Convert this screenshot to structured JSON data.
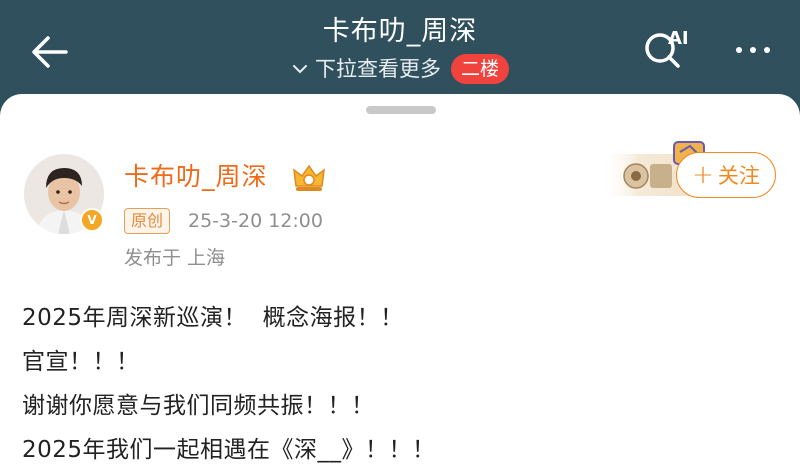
{
  "header": {
    "title": "卡布叻_周深",
    "subtitle": "下拉查看更多",
    "floor_badge": "二楼",
    "ai_label": "AI"
  },
  "author": {
    "name": "卡布叻_周深",
    "tag": "原创",
    "time": "25-3-20 12:00",
    "location": "发布于 上海"
  },
  "follow": {
    "label": "关注",
    "plus": "+"
  },
  "post": {
    "lines": [
      "2025年周深新巡演！  概念海报！！",
      "官宣！！！",
      "谢谢你愿意与我们同频共振！！！",
      "2025年我们一起相遇在《深__》！！！"
    ]
  },
  "colors": {
    "header_bg": "#30505e",
    "username": "#f06a1a",
    "follow": "#f2891f",
    "badge": "#f0433d"
  },
  "icons": [
    "back-arrow-icon",
    "chevron-down-icon",
    "ai-search-icon",
    "more-icon",
    "crown-icon",
    "verified-icon"
  ]
}
